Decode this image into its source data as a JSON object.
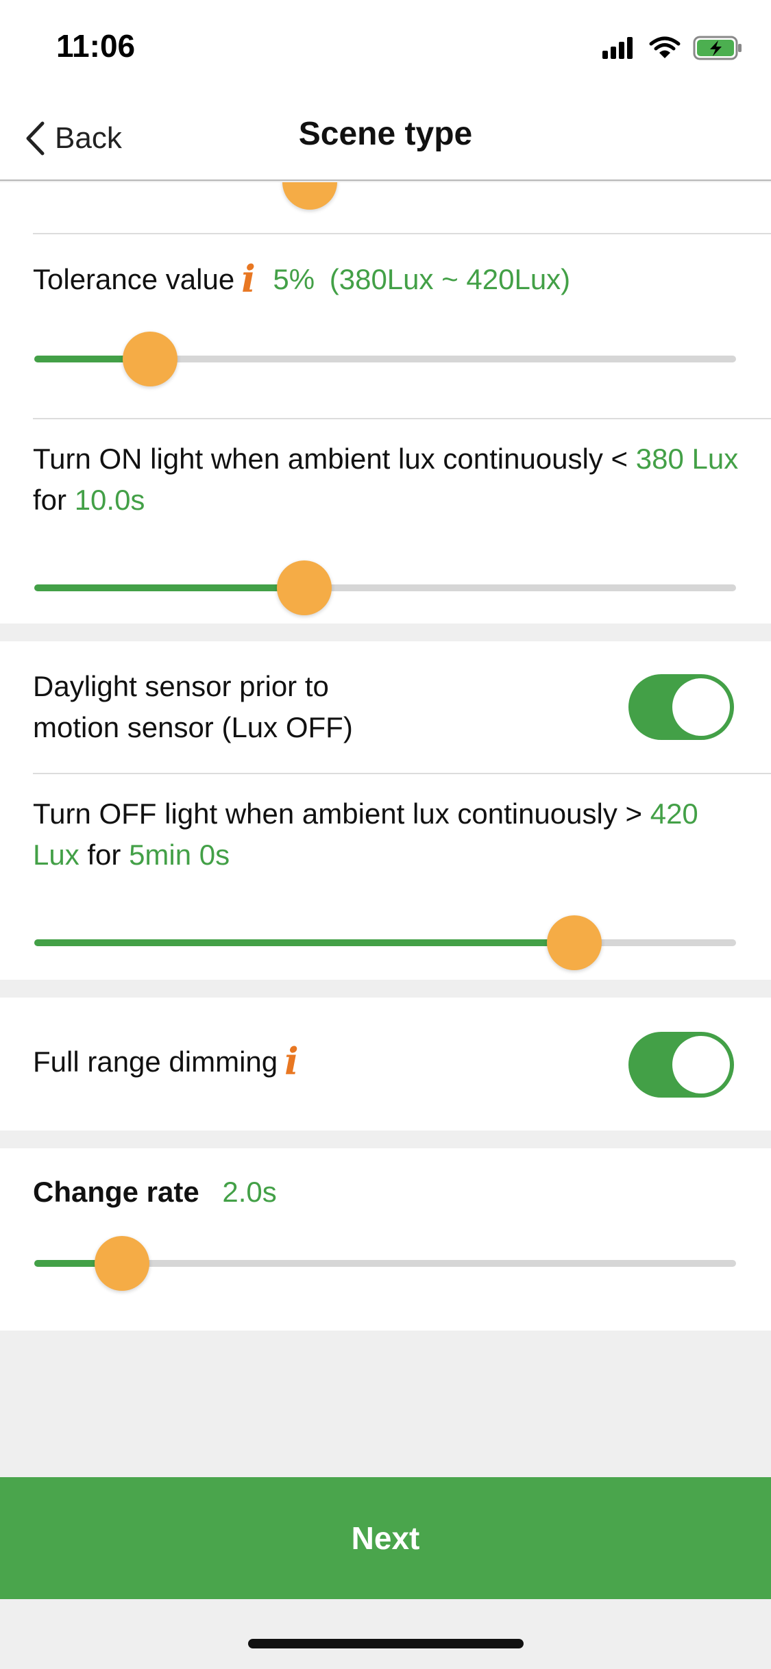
{
  "status_bar": {
    "time": "11:06",
    "icons": [
      "signal-icon",
      "wifi-icon",
      "battery-charging-icon"
    ]
  },
  "nav": {
    "back_label": "Back",
    "title": "Scene type"
  },
  "tolerance": {
    "label": "Tolerance value",
    "percent": "5%",
    "range": "(380Lux ~ 420Lux)",
    "slider_fraction": 0.165
  },
  "turn_on": {
    "prefix": "Turn ON light when ambient lux continuously <",
    "lux": "380 Lux",
    "for_word": "for",
    "duration": "10.0s",
    "slider_fraction": 0.385
  },
  "daylight_sensor": {
    "line1": "Daylight sensor prior to",
    "line2": "motion sensor (Lux OFF)",
    "enabled": true
  },
  "turn_off": {
    "prefix": "Turn OFF light when ambient lux continuously >",
    "lux": "420 Lux",
    "for_word": "for",
    "duration": "5min 0s",
    "slider_fraction": 0.77
  },
  "full_range_dimming": {
    "label": "Full range dimming",
    "enabled": true
  },
  "change_rate": {
    "label": "Change rate",
    "value": "2.0s",
    "slider_fraction": 0.125
  },
  "next_label": "Next",
  "colors": {
    "accent_green": "#43a047",
    "thumb_orange": "#f5ac46",
    "info_orange": "#e87722",
    "button_green": "#4aa54c"
  }
}
